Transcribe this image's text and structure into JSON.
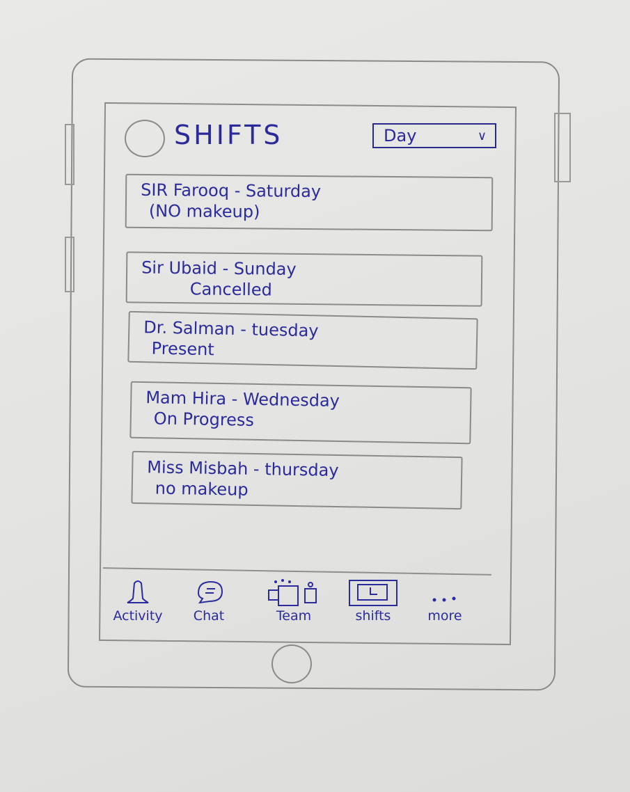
{
  "header": {
    "title": "SHIFTS",
    "view_select": {
      "value": "Day"
    }
  },
  "shifts": [
    {
      "line1": "SIR Farooq  - Saturday",
      "line2": "(NO makeup)"
    },
    {
      "line1": "Sir Ubaid - Sunday",
      "line2": "Cancelled"
    },
    {
      "line1": "Dr. Salman - tuesday",
      "line2": "Present"
    },
    {
      "line1": "Mam Hira - Wednesday",
      "line2": "On Progress"
    },
    {
      "line1": "Miss Misbah - thursday",
      "line2": "no makeup"
    }
  ],
  "tabs": [
    {
      "label": "Activity",
      "icon": "bell-icon"
    },
    {
      "label": "Chat",
      "icon": "chat-bubble-icon"
    },
    {
      "label": "Team",
      "icon": "team-icon"
    },
    {
      "label": "shifts",
      "icon": "clock-icon"
    },
    {
      "label": "more",
      "icon": "more-dots-icon"
    }
  ],
  "colors": {
    "ink": "#2b2b9c",
    "pencil": "#8a8a8a",
    "paper": "#e6e6e4"
  }
}
